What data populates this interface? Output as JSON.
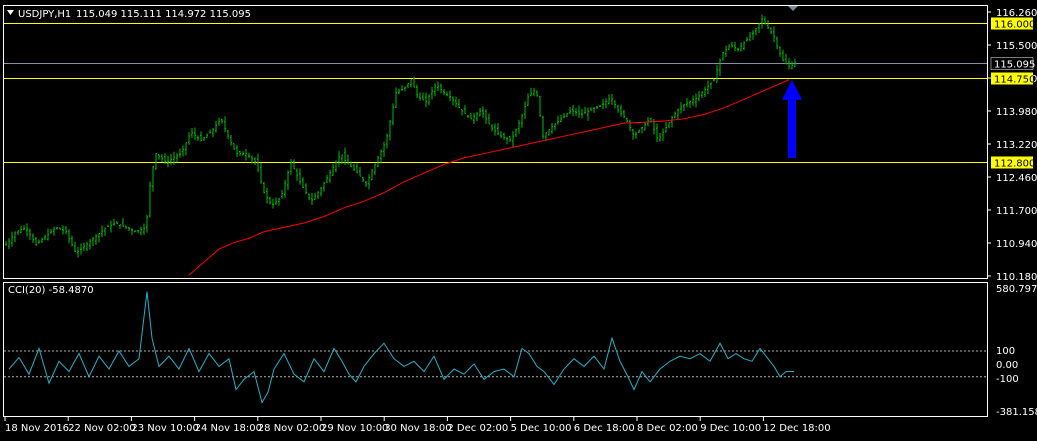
{
  "header": {
    "symbol": "USDJPY,H1",
    "ohlc": "115.049 115.111 114.972 115.095"
  },
  "indicator": {
    "label": "CCI(20) -58.4870",
    "axis_top": "580.7974",
    "axis_bottom": "-381.1584",
    "level_100": "100",
    "level_0": "0.00",
    "level_m100": "-100"
  },
  "colors": {
    "background": "#000000",
    "frame": "#ffffff",
    "candles": "#00c000",
    "moving_average": "#ff0000",
    "horizontal_levels": "#ffff00",
    "current_price_line": "#8090a0",
    "cci_line": "#20b2c8",
    "arrow": "#0000ff"
  },
  "chart_data": [
    {
      "type": "candlestick",
      "title": "USDJPY,H1",
      "y_ticks": [
        116.26,
        115.5,
        114.74,
        113.98,
        113.22,
        112.46,
        111.7,
        110.94,
        110.18
      ],
      "ylim": [
        110.18,
        116.26
      ],
      "x_ticks": [
        "18 Nov 2016",
        "22 Nov 02:00",
        "23 Nov 10:00",
        "24 Nov 18:00",
        "28 Nov 02:00",
        "29 Nov 10:00",
        "30 Nov 18:00",
        "2 Dec 02:00",
        "5 Dec 10:00",
        "6 Dec 18:00",
        "8 Dec 02:00",
        "9 Dec 10:00",
        "12 Dec 18:00"
      ],
      "horizontal_lines": [
        {
          "price": 116.0,
          "label": "116.000",
          "color": "#ffff00"
        },
        {
          "price": 114.75,
          "label": "114.750",
          "color": "#ffff00"
        },
        {
          "price": 112.8,
          "label": "112.800",
          "color": "#ffff00"
        },
        {
          "price": 115.095,
          "label": "115.095",
          "color": "#8090a0"
        }
      ],
      "price_path": [
        [
          0,
          110.9
        ],
        [
          10,
          111.2
        ],
        [
          20,
          111.3
        ],
        [
          30,
          110.9
        ],
        [
          40,
          111.1
        ],
        [
          50,
          111.3
        ],
        [
          60,
          111.2
        ],
        [
          70,
          110.7
        ],
        [
          80,
          110.9
        ],
        [
          90,
          111.1
        ],
        [
          100,
          111.3
        ],
        [
          110,
          111.4
        ],
        [
          120,
          111.3
        ],
        [
          130,
          111.2
        ],
        [
          140,
          111.3
        ],
        [
          145,
          112.5
        ],
        [
          150,
          113.0
        ],
        [
          160,
          112.8
        ],
        [
          175,
          113.0
        ],
        [
          185,
          113.5
        ],
        [
          195,
          113.3
        ],
        [
          205,
          113.5
        ],
        [
          215,
          113.8
        ],
        [
          222,
          113.4
        ],
        [
          230,
          113.0
        ],
        [
          240,
          113.0
        ],
        [
          250,
          112.8
        ],
        [
          258,
          112.1
        ],
        [
          266,
          111.8
        ],
        [
          275,
          112.0
        ],
        [
          285,
          112.8
        ],
        [
          295,
          112.3
        ],
        [
          305,
          111.9
        ],
        [
          315,
          112.2
        ],
        [
          325,
          112.6
        ],
        [
          335,
          113.0
        ],
        [
          340,
          112.8
        ],
        [
          350,
          112.6
        ],
        [
          360,
          112.3
        ],
        [
          370,
          112.8
        ],
        [
          380,
          113.3
        ],
        [
          390,
          114.4
        ],
        [
          398,
          114.5
        ],
        [
          405,
          114.7
        ],
        [
          412,
          114.3
        ],
        [
          420,
          114.2
        ],
        [
          430,
          114.6
        ],
        [
          438,
          114.4
        ],
        [
          445,
          114.3
        ],
        [
          455,
          114.0
        ],
        [
          465,
          113.8
        ],
        [
          475,
          114.0
        ],
        [
          485,
          113.6
        ],
        [
          495,
          113.4
        ],
        [
          505,
          113.3
        ],
        [
          515,
          113.8
        ],
        [
          522,
          114.3
        ],
        [
          530,
          114.5
        ],
        [
          537,
          113.4
        ],
        [
          545,
          113.6
        ],
        [
          555,
          113.8
        ],
        [
          565,
          114.0
        ],
        [
          575,
          113.9
        ],
        [
          585,
          114.0
        ],
        [
          595,
          114.1
        ],
        [
          605,
          114.3
        ],
        [
          612,
          114.0
        ],
        [
          620,
          113.8
        ],
        [
          628,
          113.4
        ],
        [
          636,
          113.6
        ],
        [
          644,
          113.8
        ],
        [
          652,
          113.3
        ],
        [
          660,
          113.6
        ],
        [
          668,
          113.9
        ],
        [
          676,
          114.1
        ],
        [
          684,
          114.2
        ],
        [
          692,
          114.3
        ],
        [
          700,
          114.5
        ],
        [
          708,
          114.7
        ],
        [
          716,
          115.3
        ],
        [
          724,
          115.5
        ],
        [
          732,
          115.4
        ],
        [
          740,
          115.6
        ],
        [
          748,
          115.8
        ],
        [
          756,
          116.1
        ],
        [
          762,
          115.9
        ],
        [
          768,
          115.7
        ],
        [
          772,
          115.4
        ],
        [
          778,
          115.1
        ],
        [
          784,
          115.0
        ],
        [
          790,
          115.1
        ]
      ],
      "moving_average_path": [
        [
          185,
          110.2
        ],
        [
          200,
          110.5
        ],
        [
          215,
          110.8
        ],
        [
          230,
          110.95
        ],
        [
          245,
          111.05
        ],
        [
          260,
          111.2
        ],
        [
          280,
          111.3
        ],
        [
          300,
          111.4
        ],
        [
          320,
          111.55
        ],
        [
          340,
          111.75
        ],
        [
          360,
          111.9
        ],
        [
          380,
          112.1
        ],
        [
          400,
          112.35
        ],
        [
          420,
          112.55
        ],
        [
          440,
          112.75
        ],
        [
          460,
          112.9
        ],
        [
          480,
          113.0
        ],
        [
          500,
          113.1
        ],
        [
          520,
          113.2
        ],
        [
          540,
          113.3
        ],
        [
          560,
          113.4
        ],
        [
          580,
          113.5
        ],
        [
          600,
          113.6
        ],
        [
          620,
          113.7
        ],
        [
          640,
          113.72
        ],
        [
          660,
          113.75
        ],
        [
          680,
          113.8
        ],
        [
          700,
          113.9
        ],
        [
          720,
          114.05
        ],
        [
          740,
          114.25
        ],
        [
          760,
          114.45
        ],
        [
          775,
          114.6
        ],
        [
          785,
          114.7
        ]
      ],
      "annotation": {
        "type": "up-arrow",
        "color": "#0000ff",
        "from_price": 112.9,
        "to_price": 114.7,
        "at_x": 788
      }
    },
    {
      "type": "line",
      "title": "CCI(20) -58.4870",
      "ylim": [
        -381.1584,
        580.7974
      ],
      "y_ticks": [
        580.7974,
        100,
        0,
        -100,
        -381.1584
      ],
      "levels": [
        100,
        -100
      ],
      "series": [
        {
          "name": "CCI(20)",
          "color": "#20b2c8",
          "points": [
            [
              5,
              -40
            ],
            [
              15,
              50
            ],
            [
              25,
              -80
            ],
            [
              35,
              120
            ],
            [
              45,
              -150
            ],
            [
              55,
              20
            ],
            [
              65,
              -60
            ],
            [
              75,
              80
            ],
            [
              85,
              -100
            ],
            [
              95,
              60
            ],
            [
              105,
              -40
            ],
            [
              115,
              100
            ],
            [
              125,
              -20
            ],
            [
              135,
              40
            ],
            [
              143,
              560
            ],
            [
              148,
              200
            ],
            [
              155,
              -20
            ],
            [
              165,
              60
            ],
            [
              175,
              -40
            ],
            [
              185,
              120
            ],
            [
              195,
              -60
            ],
            [
              205,
              80
            ],
            [
              215,
              -20
            ],
            [
              225,
              40
            ],
            [
              232,
              -200
            ],
            [
              240,
              -120
            ],
            [
              250,
              -60
            ],
            [
              258,
              -300
            ],
            [
              264,
              -220
            ],
            [
              270,
              -40
            ],
            [
              280,
              80
            ],
            [
              290,
              -80
            ],
            [
              300,
              -140
            ],
            [
              310,
              40
            ],
            [
              320,
              -60
            ],
            [
              330,
              120
            ],
            [
              338,
              20
            ],
            [
              345,
              -80
            ],
            [
              352,
              -140
            ],
            [
              360,
              -20
            ],
            [
              370,
              80
            ],
            [
              380,
              160
            ],
            [
              390,
              40
            ],
            [
              400,
              -20
            ],
            [
              410,
              20
            ],
            [
              420,
              -60
            ],
            [
              430,
              60
            ],
            [
              440,
              -120
            ],
            [
              450,
              -40
            ],
            [
              460,
              -80
            ],
            [
              470,
              0
            ],
            [
              480,
              -120
            ],
            [
              490,
              -60
            ],
            [
              500,
              -40
            ],
            [
              510,
              -100
            ],
            [
              518,
              120
            ],
            [
              525,
              80
            ],
            [
              533,
              -20
            ],
            [
              540,
              -60
            ],
            [
              550,
              -160
            ],
            [
              560,
              -40
            ],
            [
              570,
              40
            ],
            [
              580,
              -20
            ],
            [
              590,
              60
            ],
            [
              600,
              -40
            ],
            [
              608,
              200
            ],
            [
              616,
              20
            ],
            [
              624,
              -100
            ],
            [
              630,
              -200
            ],
            [
              638,
              -60
            ],
            [
              646,
              -140
            ],
            [
              656,
              -40
            ],
            [
              666,
              20
            ],
            [
              676,
              60
            ],
            [
              686,
              40
            ],
            [
              696,
              80
            ],
            [
              706,
              20
            ],
            [
              716,
              160
            ],
            [
              724,
              40
            ],
            [
              732,
              80
            ],
            [
              740,
              40
            ],
            [
              748,
              20
            ],
            [
              756,
              120
            ],
            [
              764,
              40
            ],
            [
              770,
              -20
            ],
            [
              776,
              -100
            ],
            [
              782,
              -60
            ],
            [
              790,
              -58
            ]
          ]
        }
      ]
    }
  ]
}
